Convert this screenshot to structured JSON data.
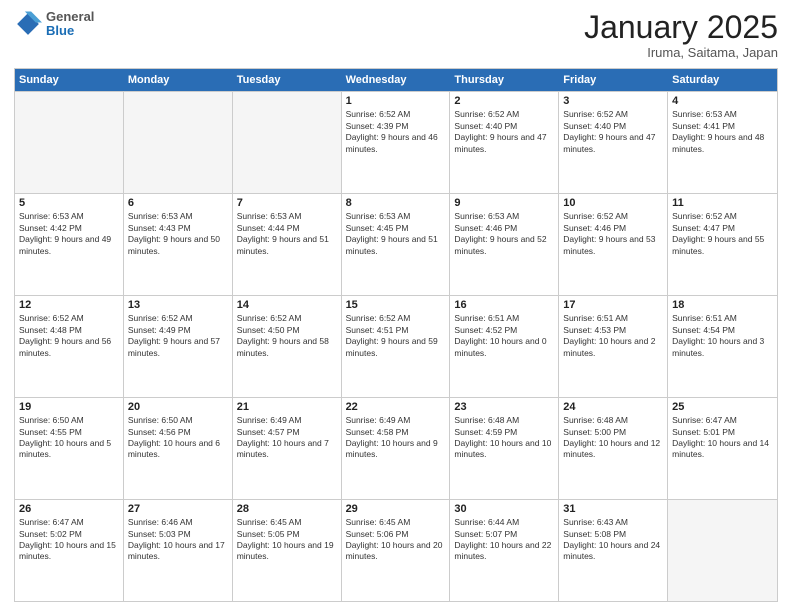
{
  "header": {
    "logo": {
      "general": "General",
      "blue": "Blue"
    },
    "title": "January 2025",
    "location": "Iruma, Saitama, Japan"
  },
  "days_of_week": [
    "Sunday",
    "Monday",
    "Tuesday",
    "Wednesday",
    "Thursday",
    "Friday",
    "Saturday"
  ],
  "weeks": [
    [
      {
        "day": "",
        "empty": true
      },
      {
        "day": "",
        "empty": true
      },
      {
        "day": "",
        "empty": true
      },
      {
        "day": "1",
        "sunrise": "6:52 AM",
        "sunset": "4:39 PM",
        "daylight": "9 hours and 46 minutes."
      },
      {
        "day": "2",
        "sunrise": "6:52 AM",
        "sunset": "4:40 PM",
        "daylight": "9 hours and 47 minutes."
      },
      {
        "day": "3",
        "sunrise": "6:52 AM",
        "sunset": "4:40 PM",
        "daylight": "9 hours and 47 minutes."
      },
      {
        "day": "4",
        "sunrise": "6:53 AM",
        "sunset": "4:41 PM",
        "daylight": "9 hours and 48 minutes."
      }
    ],
    [
      {
        "day": "5",
        "sunrise": "6:53 AM",
        "sunset": "4:42 PM",
        "daylight": "9 hours and 49 minutes."
      },
      {
        "day": "6",
        "sunrise": "6:53 AM",
        "sunset": "4:43 PM",
        "daylight": "9 hours and 50 minutes."
      },
      {
        "day": "7",
        "sunrise": "6:53 AM",
        "sunset": "4:44 PM",
        "daylight": "9 hours and 51 minutes."
      },
      {
        "day": "8",
        "sunrise": "6:53 AM",
        "sunset": "4:45 PM",
        "daylight": "9 hours and 51 minutes."
      },
      {
        "day": "9",
        "sunrise": "6:53 AM",
        "sunset": "4:46 PM",
        "daylight": "9 hours and 52 minutes."
      },
      {
        "day": "10",
        "sunrise": "6:52 AM",
        "sunset": "4:46 PM",
        "daylight": "9 hours and 53 minutes."
      },
      {
        "day": "11",
        "sunrise": "6:52 AM",
        "sunset": "4:47 PM",
        "daylight": "9 hours and 55 minutes."
      }
    ],
    [
      {
        "day": "12",
        "sunrise": "6:52 AM",
        "sunset": "4:48 PM",
        "daylight": "9 hours and 56 minutes."
      },
      {
        "day": "13",
        "sunrise": "6:52 AM",
        "sunset": "4:49 PM",
        "daylight": "9 hours and 57 minutes."
      },
      {
        "day": "14",
        "sunrise": "6:52 AM",
        "sunset": "4:50 PM",
        "daylight": "9 hours and 58 minutes."
      },
      {
        "day": "15",
        "sunrise": "6:52 AM",
        "sunset": "4:51 PM",
        "daylight": "9 hours and 59 minutes."
      },
      {
        "day": "16",
        "sunrise": "6:51 AM",
        "sunset": "4:52 PM",
        "daylight": "10 hours and 0 minutes."
      },
      {
        "day": "17",
        "sunrise": "6:51 AM",
        "sunset": "4:53 PM",
        "daylight": "10 hours and 2 minutes."
      },
      {
        "day": "18",
        "sunrise": "6:51 AM",
        "sunset": "4:54 PM",
        "daylight": "10 hours and 3 minutes."
      }
    ],
    [
      {
        "day": "19",
        "sunrise": "6:50 AM",
        "sunset": "4:55 PM",
        "daylight": "10 hours and 5 minutes."
      },
      {
        "day": "20",
        "sunrise": "6:50 AM",
        "sunset": "4:56 PM",
        "daylight": "10 hours and 6 minutes."
      },
      {
        "day": "21",
        "sunrise": "6:49 AM",
        "sunset": "4:57 PM",
        "daylight": "10 hours and 7 minutes."
      },
      {
        "day": "22",
        "sunrise": "6:49 AM",
        "sunset": "4:58 PM",
        "daylight": "10 hours and 9 minutes."
      },
      {
        "day": "23",
        "sunrise": "6:48 AM",
        "sunset": "4:59 PM",
        "daylight": "10 hours and 10 minutes."
      },
      {
        "day": "24",
        "sunrise": "6:48 AM",
        "sunset": "5:00 PM",
        "daylight": "10 hours and 12 minutes."
      },
      {
        "day": "25",
        "sunrise": "6:47 AM",
        "sunset": "5:01 PM",
        "daylight": "10 hours and 14 minutes."
      }
    ],
    [
      {
        "day": "26",
        "sunrise": "6:47 AM",
        "sunset": "5:02 PM",
        "daylight": "10 hours and 15 minutes."
      },
      {
        "day": "27",
        "sunrise": "6:46 AM",
        "sunset": "5:03 PM",
        "daylight": "10 hours and 17 minutes."
      },
      {
        "day": "28",
        "sunrise": "6:45 AM",
        "sunset": "5:05 PM",
        "daylight": "10 hours and 19 minutes."
      },
      {
        "day": "29",
        "sunrise": "6:45 AM",
        "sunset": "5:06 PM",
        "daylight": "10 hours and 20 minutes."
      },
      {
        "day": "30",
        "sunrise": "6:44 AM",
        "sunset": "5:07 PM",
        "daylight": "10 hours and 22 minutes."
      },
      {
        "day": "31",
        "sunrise": "6:43 AM",
        "sunset": "5:08 PM",
        "daylight": "10 hours and 24 minutes."
      },
      {
        "day": "",
        "empty": true
      }
    ]
  ]
}
